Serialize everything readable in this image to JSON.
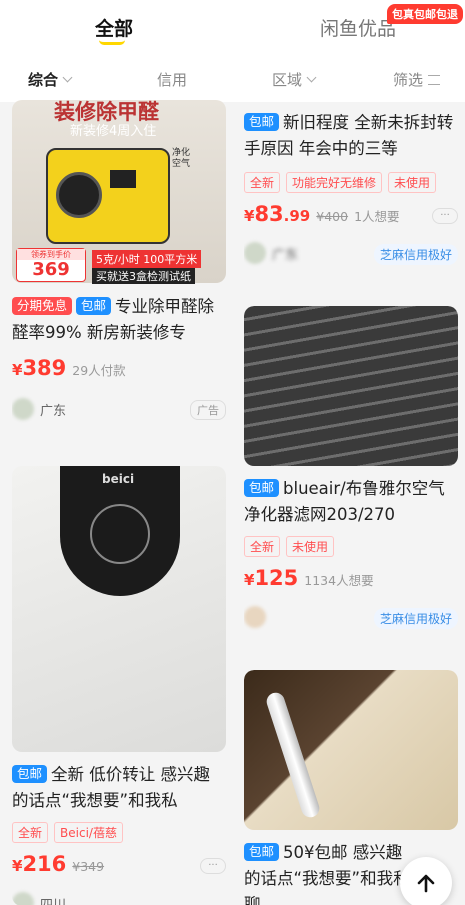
{
  "top_tabs": {
    "active": "全部",
    "inactive": "闲鱼优品",
    "promo_badge": "包真包邮包退"
  },
  "filters": [
    "综合",
    "信用",
    "区域",
    "筛选"
  ],
  "cards": {
    "left1": {
      "image_headline": "装修除甲醛",
      "image_subline": "新装修4周入住",
      "image_side_text": "净化空气",
      "image_price_label": "领券到手价",
      "image_price": "369",
      "image_banner_1": "5克/小时 100平方米",
      "image_banner_2": "买就送3盒检测试纸",
      "tag1": "分期免息",
      "tag2": "包邮",
      "title": "专业除甲醛除醛率99% 新房新装修专",
      "currency": "¥",
      "price": "389",
      "paid": "29人付款",
      "seller": "广东",
      "ad": "广告"
    },
    "left2": {
      "brand_on_image": "beici",
      "tag": "包邮",
      "title": "全新 低价转让 感兴趣的话点“我想要”和我私",
      "chips": [
        "全新",
        "Beici/蓓慈"
      ],
      "currency": "¥",
      "price": "216",
      "old_price": "¥349",
      "seller": "四川",
      "more": "···"
    },
    "right1": {
      "tag": "包邮",
      "title": "新旧程度 全新未拆封转手原因 年会中的三等",
      "chips": [
        "全新",
        "功能完好无维修",
        "未使用"
      ],
      "currency": "¥",
      "price": "83",
      "cents": ".99",
      "old_price": "¥400",
      "want": "1人想要",
      "seller": "广东",
      "credit": "芝麻信用极好",
      "more": "···"
    },
    "right2": {
      "tag": "包邮",
      "title": "blueair/布鲁雅尔空气净化器滤网203/270",
      "chips": [
        "全新",
        "未使用"
      ],
      "currency": "¥",
      "price": "125",
      "want": "1134人想要",
      "credit": "芝麻信用极好"
    },
    "right3": {
      "tag": "包邮",
      "title": "50¥包邮 感兴趣的话点“我想要”和我私聊"
    }
  }
}
